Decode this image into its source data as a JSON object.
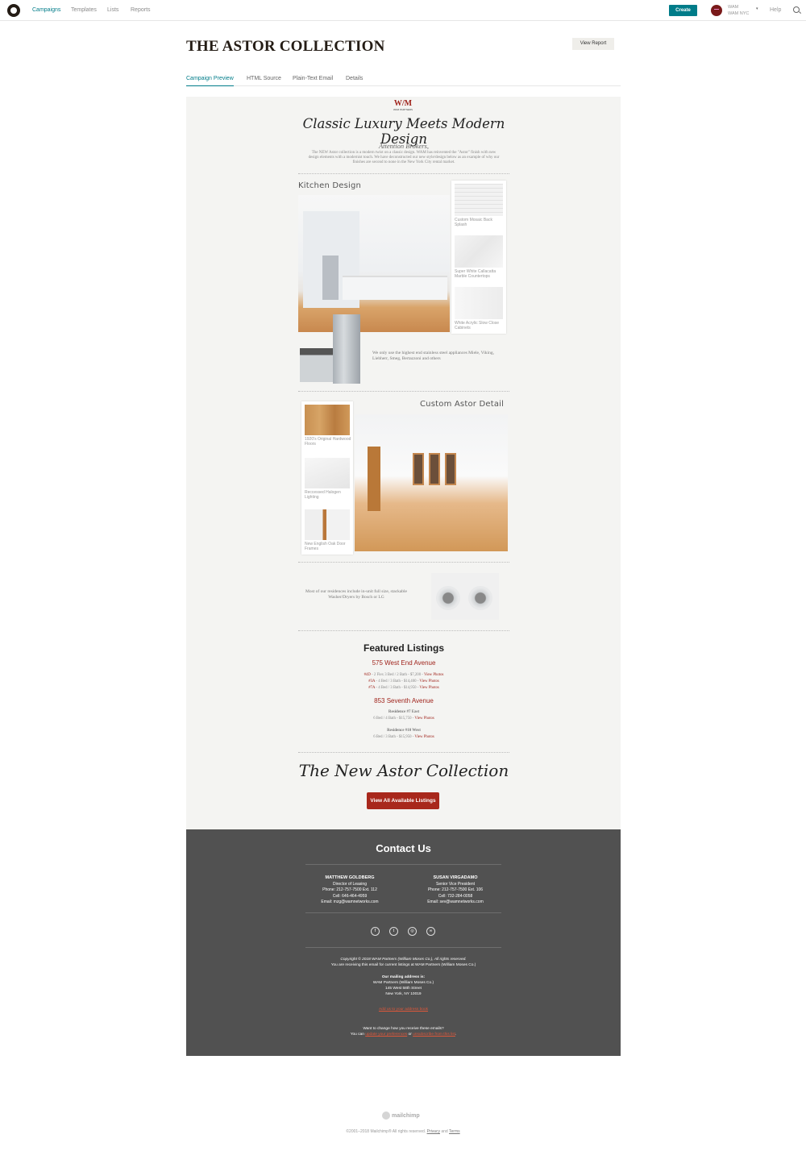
{
  "nav": {
    "items": [
      "Campaigns",
      "Templates",
      "Lists",
      "Reports"
    ],
    "create_label": "Create",
    "account_name": "WAM",
    "account_sub": "WAM NYC",
    "help_label": "Help"
  },
  "header": {
    "title": "THE ASTOR COLLECTION",
    "view_report_label": "View Report",
    "tabs": [
      "Campaign Preview",
      "HTML Source",
      "Plain-Text Email",
      "Details"
    ]
  },
  "email": {
    "logo_mark": "W/M",
    "logo_text": "WAM PARTNERS",
    "headline": "Classic Luxury Meets Modern Design",
    "attention": "Attention Brokers,",
    "intro": "The NEW Astor collection is a modern twist on a classic design. WAM has reinvented the \"Astor\" finish with new design elements with a modernist touch. We have deconstructed our new style/design below as an example of why our finishes are second to none in the New York City rental market.",
    "kitchen_heading": "Kitchen Design",
    "kitchen_swatches": [
      "Custom Mosaic Back Splash",
      "Super White Callacatta Marble Countertops",
      "White Acrylic Slow Close Cabinets"
    ],
    "appliances_text": "We only use the highest end stainless steel appliances Miele, Viking, Liebherr, Smeg, Bertazzoni and others",
    "detail_heading": "Custom Astor Detail",
    "detail_swatches": [
      "1920's Original Hardwood Floors",
      "Reccessed Halogen Lighting",
      "New English Oak Door Frames"
    ],
    "washer_text": "Most of our residences include in-unit full size, stackable Washer/Dryers by Bosch or LG",
    "featured_heading": "Featured Listings",
    "building1": "575 West End Avenue",
    "units1": [
      {
        "code": "#4D",
        "details": " - 2 Flex 3 Bed / 2 Bath - $7,200 - ",
        "link": "View Photos"
      },
      {
        "code": "#3A",
        "details": " - 4 Bed / 3 Bath - $14,400 - ",
        "link": "View Photos"
      },
      {
        "code": "#7A",
        "details": " - 4 Bed / 3 Bath - $14,950 - ",
        "link": "View Photos"
      }
    ],
    "building2": "853 Seventh Avenue",
    "residence1": "Residence #7 East",
    "residence1_details": "6 Bed / 4 Bath - $15,750 - ",
    "residence2": "Residence #10 West",
    "residence2_details": "6 Bed / 3 Bath - $15,950 - ",
    "view_photos": "View Photos",
    "closing_script": "The New Astor Collection",
    "cta_label": "View All Available Listings"
  },
  "footer": {
    "contact_heading": "Contact Us",
    "person1": {
      "name": "MATTHEW GOLDBERG",
      "title": "Director of Leasing",
      "phone": "Phone: 212-757-7500 Ext. 112",
      "cell": "Cell: 646-464-4959",
      "email": "Email: mzg@wamnetworks.com"
    },
    "person2": {
      "name": "SUSAN VIRGADAMO",
      "title": "Senior Vice President",
      "phone": "Phone: 212-757-7500 Ext. 106",
      "cell": "Cell: 732-284-0058",
      "email": "Email: sev@wamnetworks.com"
    },
    "social_icons": [
      "facebook-icon",
      "twitter-icon",
      "instagram-icon",
      "website-icon"
    ],
    "copyright": "Copyright © 2018 WAM Partners (William Moses Co.), All rights reserved.",
    "receiving": "You are receiving this email for current listings at WAM Partners (William Moses Co.)",
    "mailing_heading": "Our mailing address is:",
    "address1": "WAM Partners (William Moses Co.)",
    "address2": "145 West 58th Street",
    "address3": "New York, NY 10019",
    "add_link": "Add us to your address book",
    "change_q": "Want to change how you receive these emails?",
    "you_can": "You can ",
    "update_link": "update your preferences",
    "or_text": " or ",
    "unsub_link": "unsubscribe from this list",
    "period": "."
  },
  "page_footer": {
    "brand": "mailchimp",
    "copyright": "©2001–2018 Mailchimp® All rights reserved.",
    "privacy": "Privacy",
    "and": "and",
    "terms": "Terms"
  },
  "colors": {
    "accent": "#007c89",
    "brand_red": "#a0241c",
    "footer_bg": "#515151"
  }
}
